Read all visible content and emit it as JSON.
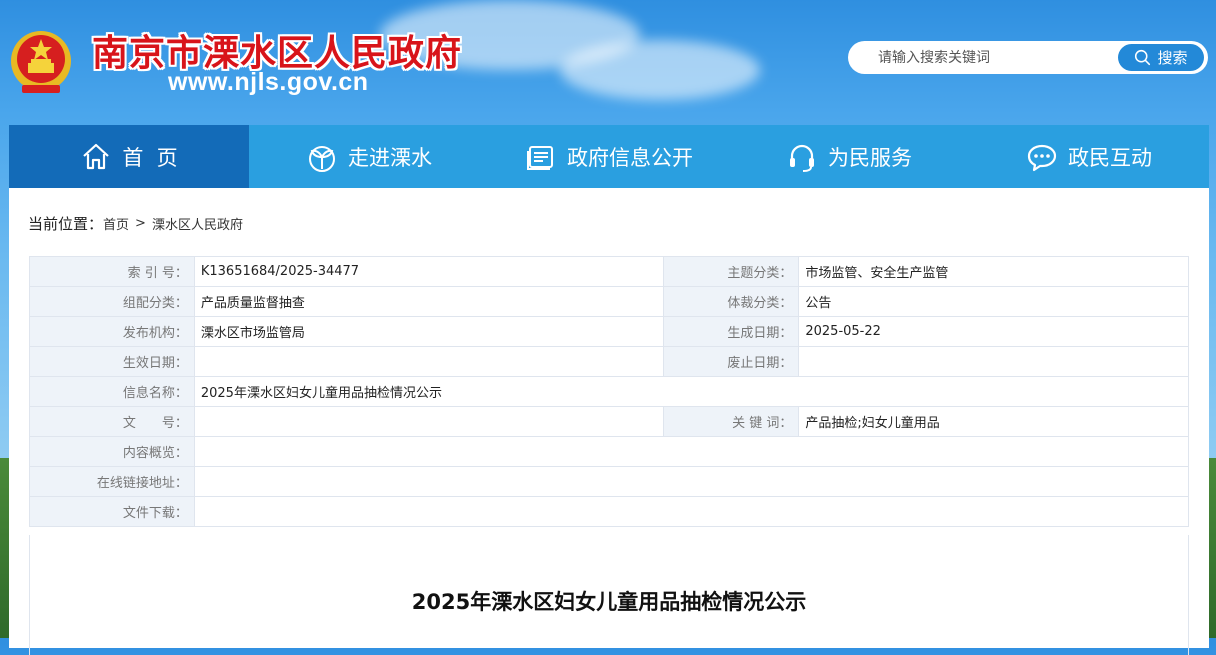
{
  "site": {
    "title": "南京市溧水区人民政府",
    "url": "www.njls.gov.cn"
  },
  "search": {
    "placeholder": "请输入搜索关键词",
    "button_label": "搜索"
  },
  "nav": {
    "items": [
      {
        "label": "首  页",
        "icon": "home-icon"
      },
      {
        "label": "走进溧水",
        "icon": "leaf-icon"
      },
      {
        "label": "政府信息公开",
        "icon": "document-icon"
      },
      {
        "label": "为民服务",
        "icon": "headset-icon"
      },
      {
        "label": "政民互动",
        "icon": "chat-icon"
      }
    ]
  },
  "breadcrumb": {
    "label": "当前位置：",
    "items": [
      "首页",
      "溧水区人民政府"
    ],
    "sep": ">"
  },
  "meta": {
    "index_key": "索 引 号：",
    "index_val": "K13651684/2025-34477",
    "topic_key": "主题分类：",
    "topic_val": "市场监管、安全生产监管",
    "group_key": "组配分类：",
    "group_val": "产品质量监督抽查",
    "genre_key": "体裁分类：",
    "genre_val": "公告",
    "org_key": "发布机构：",
    "org_val": "溧水区市场监管局",
    "gen_key": "生成日期：",
    "gen_val": "2025-05-22",
    "eff_key": "生效日期：",
    "eff_val": "",
    "exp_key": "废止日期：",
    "exp_val": "",
    "name_key": "信息名称：",
    "name_val": "2025年溧水区妇女儿童用品抽检情况公示",
    "doc_key": "文　　号：",
    "doc_val": "",
    "kw_key": "关 键 词：",
    "kw_val": "产品抽检;妇女儿童用品",
    "summary_key": "内容概览：",
    "summary_val": "",
    "link_key": "在线链接地址：",
    "link_val": "",
    "download_key": "文件下载：",
    "download_val": ""
  },
  "article": {
    "title": "2025年溧水区妇女儿童用品抽检情况公示"
  },
  "colors": {
    "nav_bg": "#2a9fe0",
    "nav_active": "#136bb8",
    "title_red": "#d8141a"
  }
}
